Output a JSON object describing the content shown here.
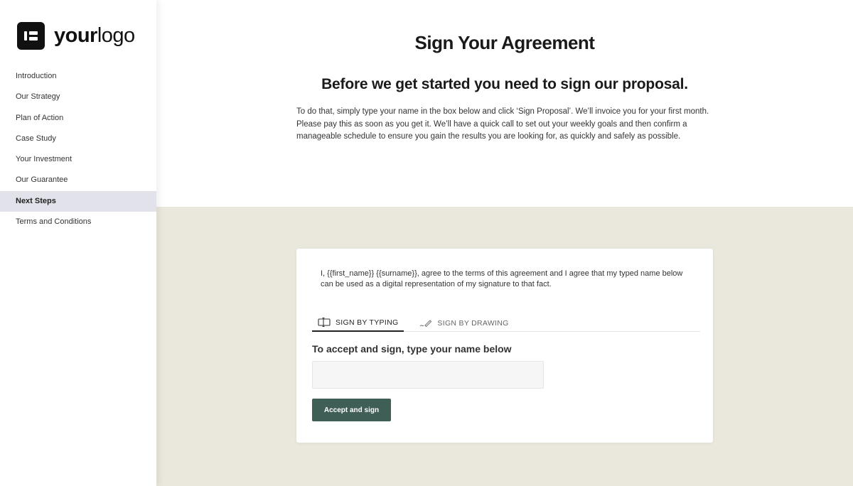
{
  "logo": {
    "text_bold": "your",
    "text_regular": "logo"
  },
  "sidebar": {
    "items": [
      {
        "label": "Introduction"
      },
      {
        "label": "Our Strategy"
      },
      {
        "label": "Plan of Action"
      },
      {
        "label": "Case Study"
      },
      {
        "label": "Your Investment"
      },
      {
        "label": "Our Guarantee"
      },
      {
        "label": "Next Steps"
      },
      {
        "label": "Terms and Conditions"
      }
    ],
    "active": "Next Steps"
  },
  "main": {
    "title": "Sign Your Agreement",
    "subtitle": "Before we get started you need to sign our proposal.",
    "intro": "To do that, simply type your name in the box below and click ‘Sign Proposal’. We’ll invoice you for your first month. Please pay this as soon as you get it. We’ll have a quick call to set out your weekly goals and then confirm a manageable schedule to ensure you gain the results you are looking for, as quickly and safely as possible."
  },
  "signature_card": {
    "agreement_text": "I, {{first_name}} {{surname}}, agree to the terms of this agreement and I agree that my typed name below can be used as a digital representation of my signature to that fact.",
    "tabs": [
      {
        "label": "SIGN BY TYPING",
        "icon": "typing-icon"
      },
      {
        "label": "SIGN BY DRAWING",
        "icon": "pen-icon"
      }
    ],
    "active_tab": "SIGN BY TYPING",
    "input_label": "To accept and sign, type your name below",
    "input_value": "",
    "input_placeholder": "",
    "button_label": "Accept and sign"
  },
  "colors": {
    "accent_button": "#3f5f56",
    "bottom_background": "#eae8dd",
    "active_nav": "#e2e3ea"
  }
}
